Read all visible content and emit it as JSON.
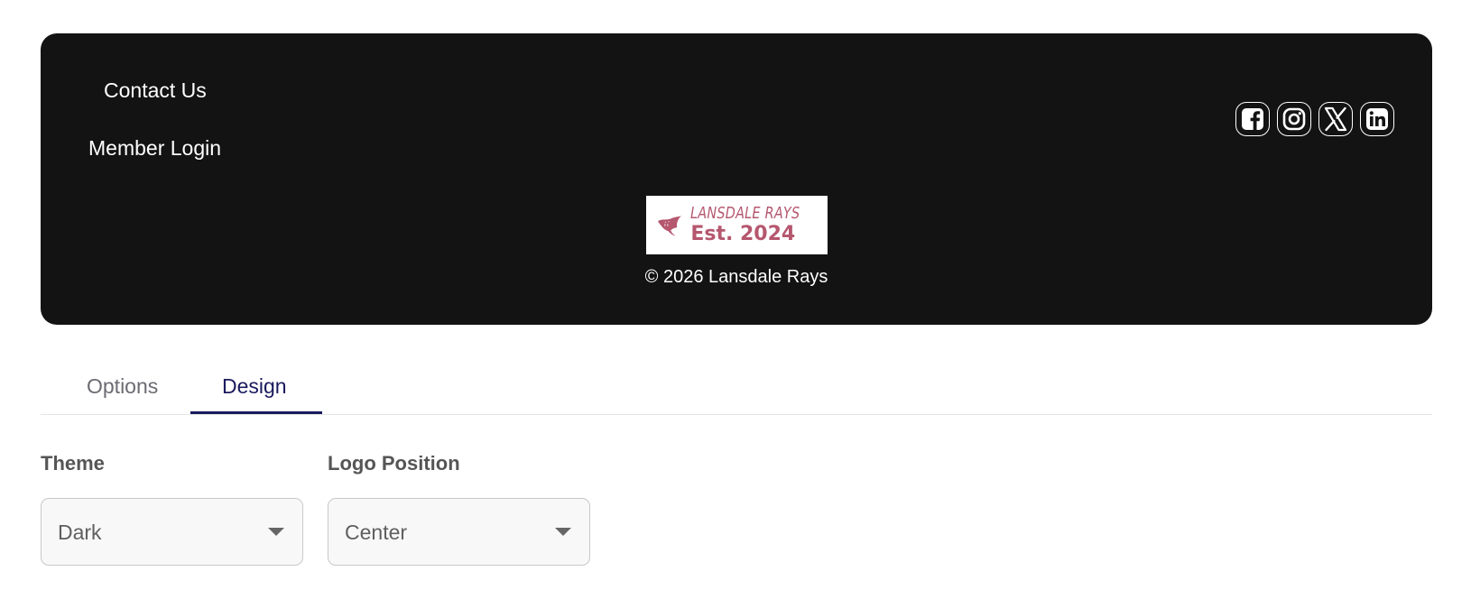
{
  "footer": {
    "nav_links": [
      "Contact Us",
      "Member Login"
    ],
    "socials": [
      "facebook-icon",
      "instagram-icon",
      "x-icon",
      "linkedin-icon"
    ],
    "logo": {
      "name": "LANSDALE RAYS",
      "established": "Est. 2024",
      "color": "#b5576e"
    },
    "copyright": "© 2026 Lansdale Rays",
    "background": "#131313"
  },
  "tabs": {
    "items": [
      "Options",
      "Design"
    ],
    "active": "Design",
    "active_color": "#1a1a5e"
  },
  "fields": {
    "theme": {
      "label": "Theme",
      "value": "Dark"
    },
    "logo_position": {
      "label": "Logo Position",
      "value": "Center"
    }
  }
}
